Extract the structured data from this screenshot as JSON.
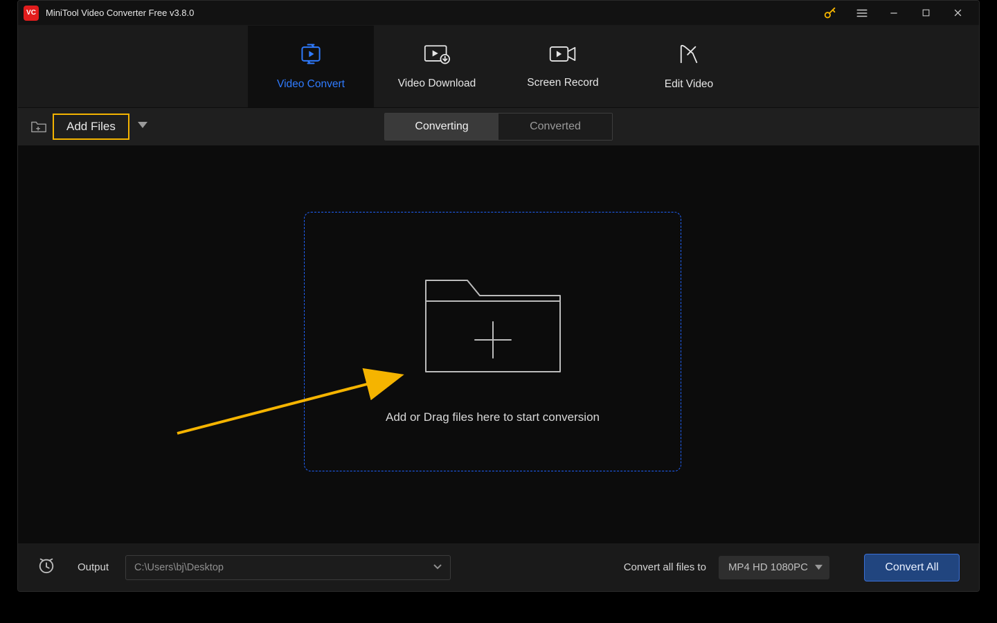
{
  "titlebar": {
    "app_title": "MiniTool Video Converter Free v3.8.0"
  },
  "nav": {
    "items": [
      {
        "label": "Video Convert"
      },
      {
        "label": "Video Download"
      },
      {
        "label": "Screen Record"
      },
      {
        "label": "Edit Video"
      }
    ]
  },
  "toolbar": {
    "add_files_label": "Add Files",
    "segments": {
      "converting": "Converting",
      "converted": "Converted"
    }
  },
  "dropzone": {
    "hint": "Add or Drag files here to start conversion"
  },
  "footer": {
    "output_label": "Output",
    "output_path": "C:\\Users\\bj\\Desktop",
    "convert_all_files_to_label": "Convert all files to",
    "format_selected": "MP4 HD 1080PC",
    "convert_all_label": "Convert All"
  },
  "colors": {
    "accent_blue": "#2f7bff",
    "highlight_yellow": "#f5b400"
  }
}
